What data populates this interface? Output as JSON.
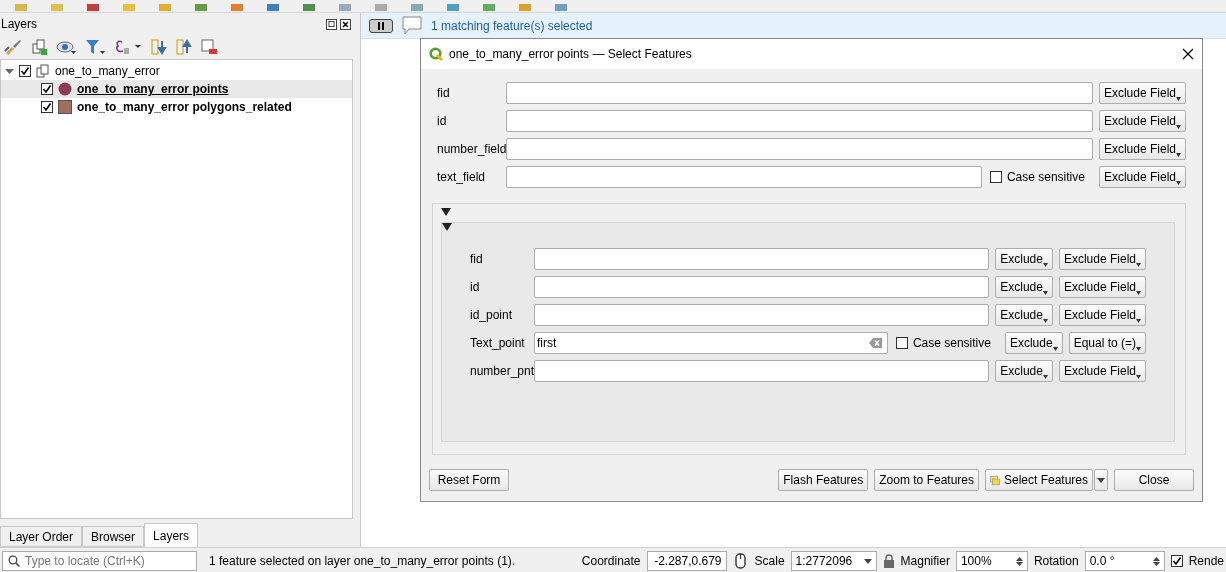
{
  "layers_panel": {
    "title": "Layers",
    "tree": [
      {
        "label": "one_to_many_error",
        "kind": "group",
        "checked": true,
        "expanded": true,
        "selected": false,
        "children": [
          {
            "label": "one_to_many_error points",
            "kind": "point",
            "checked": true,
            "selected": true,
            "color": "#8e3a59"
          },
          {
            "label": "one_to_many_error polygons_related",
            "kind": "polygon",
            "checked": true,
            "selected": false,
            "color": "#a0705a"
          }
        ]
      }
    ],
    "tabs": [
      {
        "label": "Layer Order",
        "selected": false
      },
      {
        "label": "Browser",
        "selected": false
      },
      {
        "label": "Layers",
        "selected": true
      }
    ]
  },
  "message_bar": {
    "text": "1 matching feature(s) selected"
  },
  "dialog": {
    "title": "one_to_many_error points — Select Features",
    "fields": [
      {
        "label": "fid",
        "kind": "plain",
        "buttons": [
          "Exclude Field"
        ]
      },
      {
        "label": "id",
        "kind": "plain",
        "buttons": [
          "Exclude Field"
        ]
      },
      {
        "label": "number_field",
        "kind": "plain",
        "buttons": [
          "Exclude Field"
        ]
      },
      {
        "label": "text_field",
        "kind": "text",
        "case_label": "Case sensitive",
        "case_checked": false,
        "buttons": [
          "Exclude Field"
        ]
      }
    ],
    "relation": {
      "expanded": true,
      "inner_expanded": true,
      "fields": [
        {
          "label": "fid",
          "kind": "plain",
          "buttons": [
            "Exclude",
            "Exclude Field"
          ]
        },
        {
          "label": "id",
          "kind": "plain",
          "buttons": [
            "Exclude",
            "Exclude Field"
          ]
        },
        {
          "label": "id_point",
          "kind": "plain",
          "buttons": [
            "Exclude",
            "Exclude Field"
          ]
        },
        {
          "label": "Text_point",
          "kind": "text",
          "value": "first",
          "case_label": "Case sensitive",
          "case_checked": false,
          "buttons": [
            "Exclude",
            "Equal to (=)"
          ]
        },
        {
          "label": "number_pnt",
          "kind": "plain",
          "buttons": [
            "Exclude",
            "Exclude Field"
          ]
        }
      ]
    },
    "footer": {
      "reset": "Reset Form",
      "flash": "Flash Features",
      "zoom": "Zoom to Features",
      "select": "Select Features",
      "close": "Close"
    }
  },
  "status_bar": {
    "locate_placeholder": "Type to locate (Ctrl+K)",
    "message": "1 feature selected on layer one_to_many_error points (1).",
    "coordinate_label": "Coordinate",
    "coordinate": "-2.287,0.679",
    "scale_label": "Scale",
    "scale": "1:2772096",
    "magnifier_label": "Magnifier",
    "magnifier": "100%",
    "rotation_label": "Rotation",
    "rotation": "0.0 °",
    "render_label": "Rende",
    "render_checked": true
  }
}
